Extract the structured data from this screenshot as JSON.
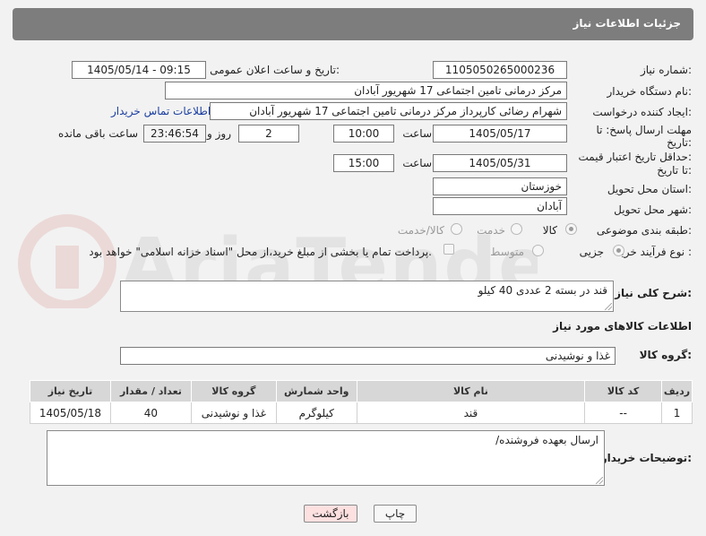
{
  "header": {
    "title": "جزئیات اطلاعات نیاز"
  },
  "form": {
    "need_number_label": "شماره نیاز:",
    "need_number": "1105050265000236",
    "announce_label": "تاریخ و ساعت اعلان عمومی:",
    "announce_value": "1405/05/14 - 09:15",
    "buyer_org_label": "نام دستگاه خریدار:",
    "buyer_org": "مرکز درمانی تامین اجتماعی 17 شهریور آبادان",
    "creator_label": "ایجاد کننده درخواست:",
    "creator": "شهرام رضائی کارپرداز مرکز درمانی تامین اجتماعی 17 شهریور آبادان",
    "contact_link": "اطلاعات تماس خریدار",
    "reply_deadline_label_1": "مهلت ارسال پاسخ: تا",
    "reply_deadline_label_2": "تاریخ:",
    "reply_date": "1405/05/17",
    "time_label": "ساعت",
    "reply_time": "10:00",
    "days_value": "2",
    "days_label": "روز و",
    "countdown": "23:46:54",
    "remaining_label": "ساعت باقی مانده",
    "price_validity_label_1": "حداقل تاریخ اعتبار قیمت:",
    "price_validity_label_2": "تا تاریخ:",
    "price_date": "1405/05/31",
    "price_time": "15:00",
    "province_label": "استان محل تحویل:",
    "province": "خوزستان",
    "city_label": "شهر محل تحویل:",
    "city": "آبادان",
    "category_label": "طبقه بندی موضوعی:",
    "category_options": [
      "کالا",
      "خدمت",
      "کالا/خدمت"
    ],
    "category_selected": "کالا",
    "process_label": "نوع فرآیند خرید :",
    "process_options": [
      "جزیی",
      "متوسط"
    ],
    "process_selected": "جزیی",
    "payment_note": "پرداخت تمام یا بخشی از مبلغ خرید،از محل \"اسناد خزانه اسلامی\" خواهد بود."
  },
  "description": {
    "label": "شرح کلی نیاز:",
    "value": "قند در بسته 2 عددی 40 کیلو"
  },
  "goods_section": {
    "title": "اطلاعات کالاهای مورد نیاز",
    "group_label": "گروه کالا:",
    "group_value": "غذا و نوشیدنی"
  },
  "table": {
    "columns": [
      "ردیف",
      "کد کالا",
      "نام کالا",
      "واحد شمارش",
      "گروه کالا",
      "تعداد / مقدار",
      "تاریخ نیاز"
    ],
    "rows": [
      [
        "1",
        "--",
        "قند",
        "کیلوگرم",
        "غذا و نوشیدنی",
        "40",
        "1405/05/18"
      ]
    ]
  },
  "buyer_notes": {
    "label": "توضیحات خریدار:",
    "value": "ارسال بعهده فروشنده/"
  },
  "buttons": {
    "print": "چاپ",
    "back": "بازگشت"
  },
  "colors": {
    "header_bg": "#7d7d7d",
    "link": "#1a3ea0",
    "back_button_bg": "#fde0e0"
  }
}
